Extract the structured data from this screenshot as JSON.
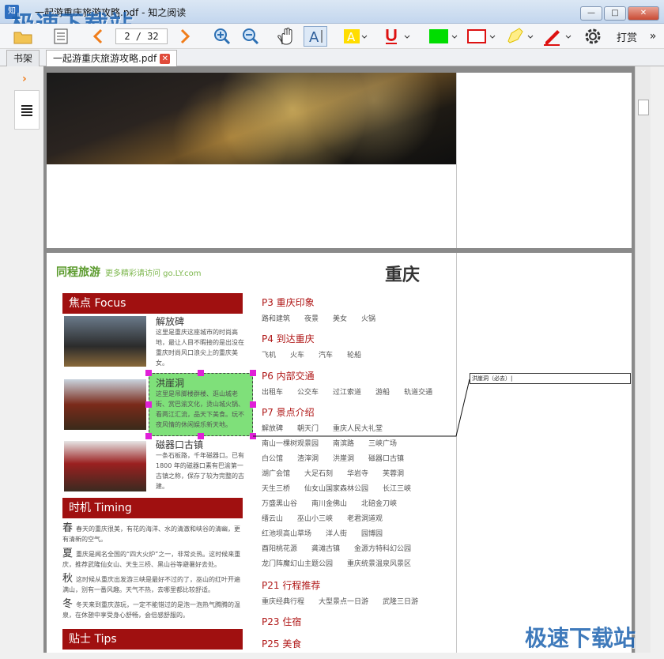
{
  "window": {
    "title": "一起游重庆旅游攻略.pdf - 知之阅读",
    "app_icon": "知",
    "minimize": "—",
    "maximize": "□",
    "close": "✕"
  },
  "watermark": "极速下载站",
  "toolbar": {
    "page_display": "2 / 32",
    "reward_label": "打赏",
    "more": "»",
    "colors": {
      "accent": "#f07d1b",
      "highlight_green": "#00dd00",
      "text_yellow": "#ffdd00",
      "underline_red": "#dd1111"
    }
  },
  "tabs": [
    {
      "label": "书架"
    },
    {
      "label": "一起游重庆旅游攻略.pdf"
    }
  ],
  "sidebar": {
    "expand": "›"
  },
  "pdf": {
    "logo": "同程旅游",
    "logo_sub": "更多精彩请访问 go.LY.com",
    "city_title": "重庆",
    "focus_header": "焦点 Focus",
    "timing_header": "时机 Timing",
    "tips_header": "贴士 Tips",
    "spots": [
      {
        "title": "解放碑",
        "desc": "这里是重庆这座城市的时尚高地，最让人目不暇接的是出没在重庆时尚风口浪尖上的重庆美女。"
      },
      {
        "title": "洪崖洞",
        "desc": "这里是吊脚楼群楼、逛山城老街、赏巴渝文化，烫山城火锅、看两江汇流，品天下美食。玩不夜风情的休闲娱乐新天地。"
      },
      {
        "title": "磁器口古镇",
        "desc": "一条石板路，千年磁器口。已有 1800 年的磁器口素有巴渝第一古镇之称，保存了较为完整的古建。"
      }
    ],
    "seasons": [
      {
        "s": "春",
        "t": "春天的重庆很美，有花的海洋、水的清澈和峡谷的清幽，更有清新的空气。"
      },
      {
        "s": "夏",
        "t": "重庆是闻名全国的“四大火炉”之一，非常炎热。这时候来重庆，推荐武隆仙女山、天生三桥、黑山谷等避暑好去处。"
      },
      {
        "s": "秋",
        "t": "这时候从重庆出发游三峡是最好不过的了，巫山的红叶开遍满山，别有一番风趣。天气不热，去哪里都比较舒适。"
      },
      {
        "s": "冬",
        "t": "冬天来到重庆游玩，一定不能错过的是泡一泡热气腾腾的温泉，在休憩中享受身心舒畅，会倍感舒服的。"
      }
    ],
    "toc": [
      {
        "h": "P3 重庆印象",
        "items": [
          "路和建筑",
          "夜景",
          "美女",
          "火锅"
        ]
      },
      {
        "h": "P4 到达重庆",
        "items": [
          "飞机",
          "火车",
          "汽车",
          "轮船"
        ]
      },
      {
        "h": "P6 内部交通",
        "items": [
          "出租车",
          "公交车",
          "过江索道",
          "游船",
          "轨道交通"
        ]
      },
      {
        "h": "P7 景点介绍",
        "items": [
          "解放碑",
          "朝天门",
          "重庆人民大礼堂"
        ]
      }
    ],
    "toc_more": [
      [
        "南山一棵树观景园",
        "南滨路",
        "三峡广场"
      ],
      [
        "白公馆",
        "渣滓洞",
        "洪崖洞",
        "磁器口古镇"
      ],
      [
        "湖广会馆",
        "大足石刻",
        "华岩寺",
        "芙蓉洞"
      ],
      [
        "天生三桥",
        "仙女山国家森林公园",
        "长江三峡"
      ],
      [
        "万盛黑山谷",
        "南川金佛山",
        "北碚金刀峡"
      ],
      [
        "缙云山",
        "巫山小三峡",
        "老君洞道观"
      ],
      [
        "红池坝高山草场",
        "洋人街",
        "园博园"
      ],
      [
        "酉阳桃花源",
        "龚滩古镇",
        "金源方特科幻公园"
      ],
      [
        "龙门阵魔幻山主题公园",
        "重庆统景温泉风景区"
      ]
    ],
    "toc_tail": [
      {
        "h": "P21 行程推荐",
        "items": [
          "重庆经典行程",
          "大型景点一日游",
          "武隆三日游"
        ]
      },
      {
        "h": "P23 住宿",
        "items": []
      },
      {
        "h": "P25 美食",
        "items": []
      }
    ],
    "annotation_note": "洪崖洞（必去）|"
  }
}
